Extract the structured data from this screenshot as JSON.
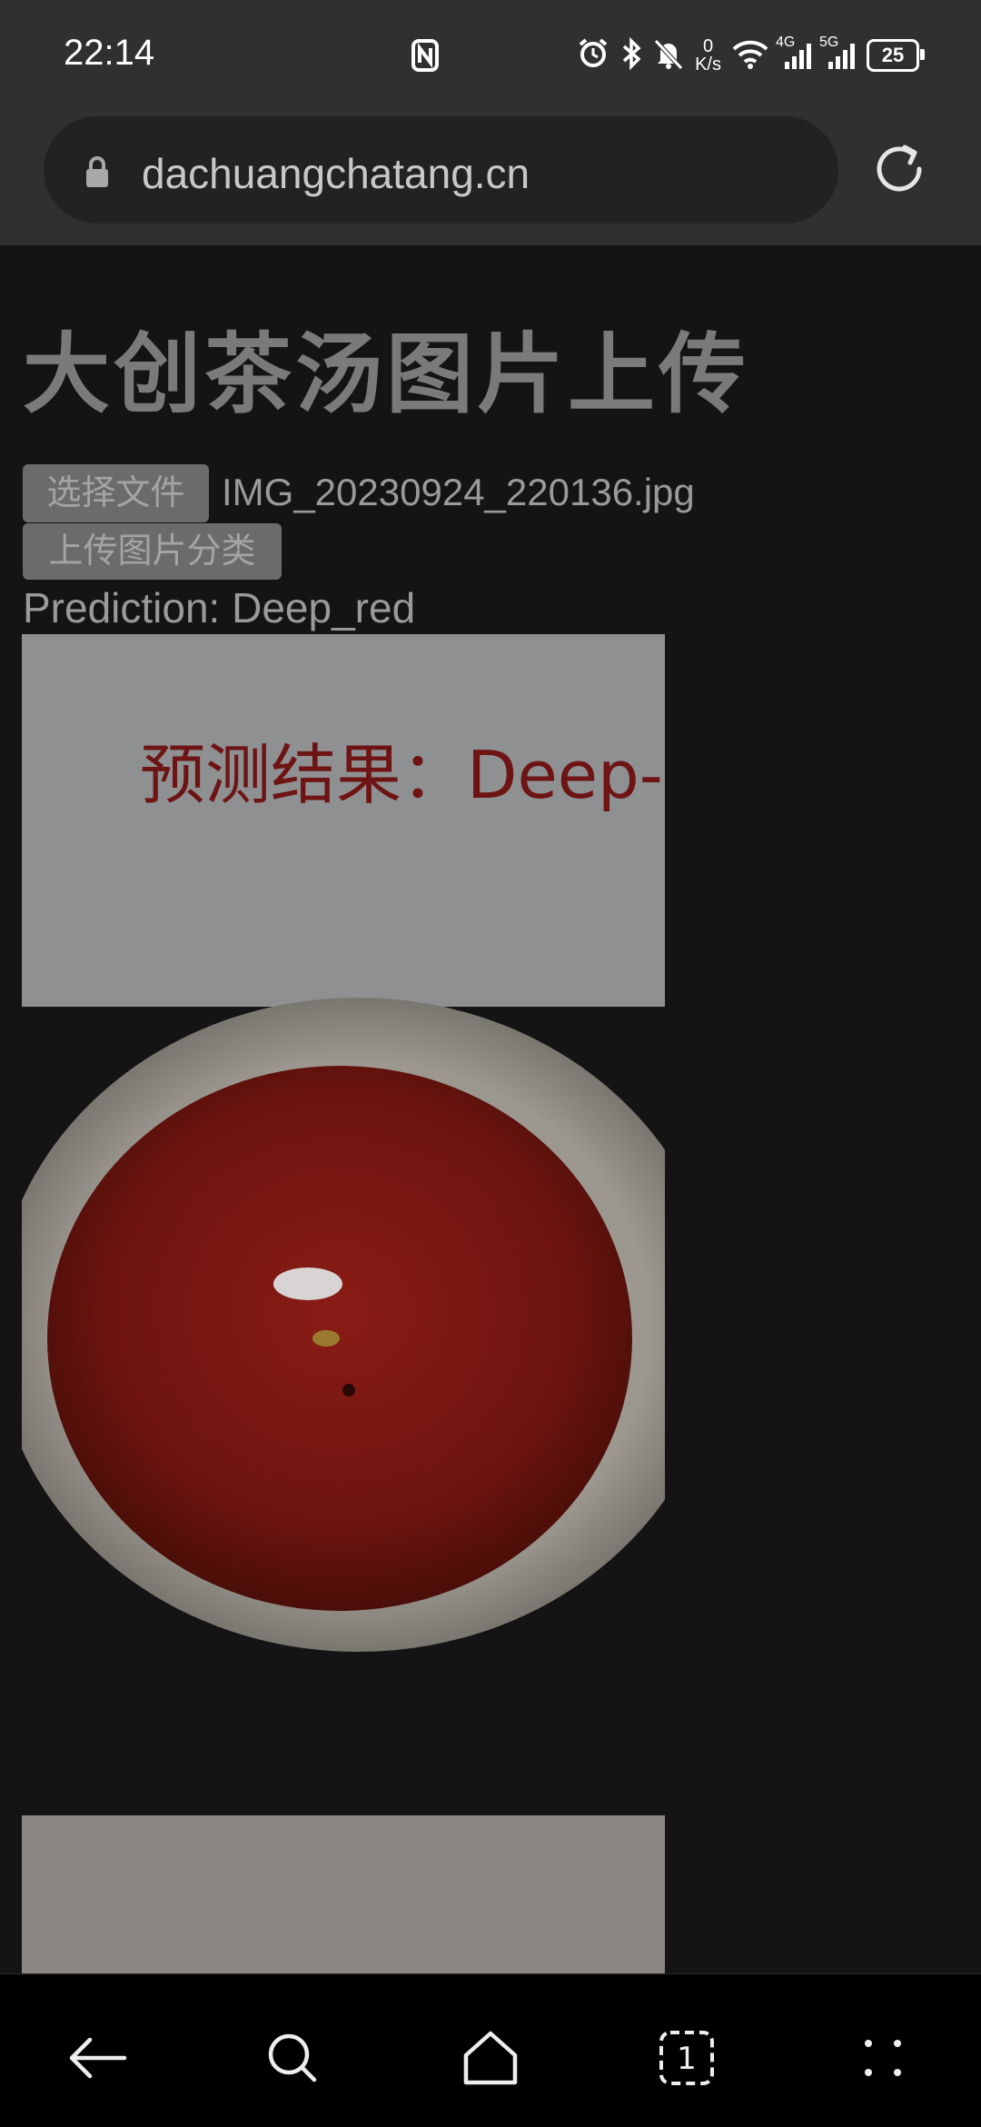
{
  "status_bar": {
    "time": "22:14",
    "net_speed_value": "0",
    "net_speed_unit": "K/s",
    "signal_1_label": "4G",
    "signal_2_label": "5G",
    "battery_level": "25",
    "icons": [
      "nfc-icon",
      "alarm-icon",
      "bluetooth-icon",
      "mute-icon",
      "wifi-icon",
      "signal-icon",
      "battery-icon"
    ]
  },
  "browser": {
    "url": "dachuangchatang.cn",
    "icons": [
      "lock-icon",
      "reload-icon"
    ]
  },
  "page": {
    "title": "大创茶汤图片上传",
    "choose_file_label": "选择文件",
    "file_name": "IMG_20230924_220136.jpg",
    "upload_label": "上传图片分类",
    "prediction": "Prediction: Deep_red",
    "photo_caption": "预测结果：Deep-rec"
  },
  "nav": {
    "items": [
      "back-icon",
      "search-icon",
      "home-icon",
      "tabs-icon",
      "menu-icon"
    ],
    "tabs_count": "1"
  },
  "colors": {
    "status_bg": "#303030",
    "page_bg": "#141414",
    "nav_bg": "#000000",
    "tea_red": "#7a1a14"
  }
}
